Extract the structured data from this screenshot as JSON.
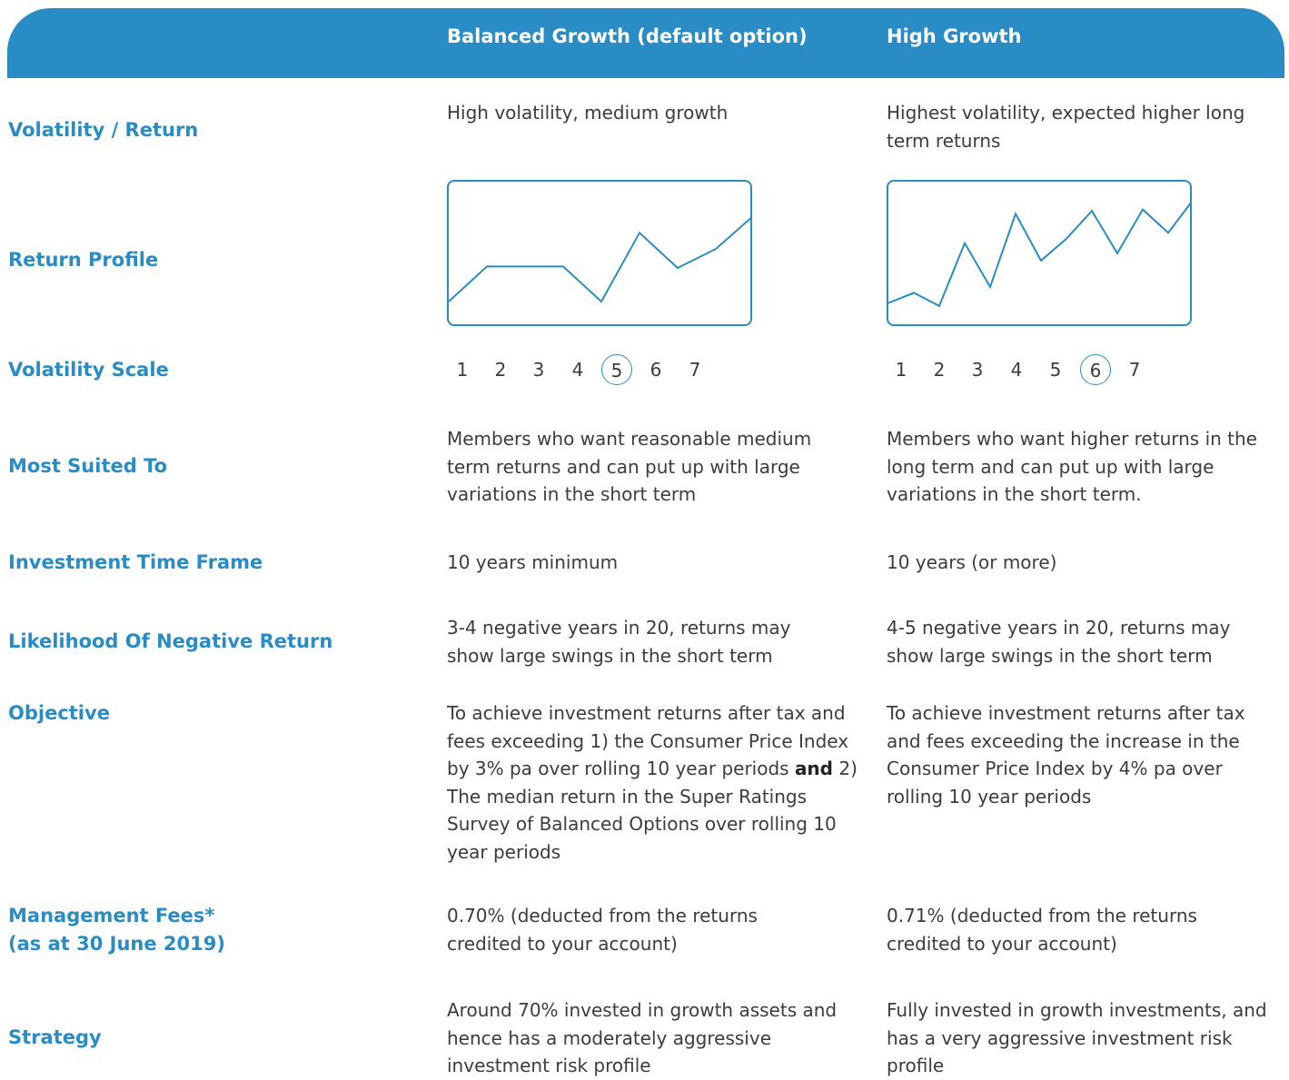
{
  "header": {
    "col1_title": "Balanced Growth (default option)",
    "col2_title": "High Growth"
  },
  "rows": {
    "volatility_return": {
      "label": "Volatility / Return",
      "col1": "High volatility, medium growth",
      "col2": "Highest volatility, expected higher long term returns"
    },
    "return_profile": {
      "label": "Return Profile"
    },
    "volatility_scale": {
      "label": "Volatility Scale",
      "numbers": [
        "1",
        "2",
        "3",
        "4",
        "5",
        "6",
        "7"
      ],
      "col1_selected": 5,
      "col2_selected": 6
    },
    "most_suited": {
      "label": "Most Suited To",
      "col1": "Members who want reasonable medium term returns and can put up with large variations in the short term",
      "col2": "Members who want higher returns in the long term and can put up with large variations in the short term."
    },
    "time_frame": {
      "label": "Investment Time Frame",
      "col1": "10 years minimum",
      "col2": "10 years (or more)"
    },
    "negative_return": {
      "label": "Likelihood Of Negative Return",
      "col1": "3-4 negative years in 20, returns may show large swings in the short term",
      "col2": "4-5 negative years in 20, returns may show large swings in the short term"
    },
    "objective": {
      "label": "Objective",
      "col1_part1": "To achieve investment returns after tax and fees exceeding 1) the Consumer Price Index by 3% pa over rolling 10 year periods",
      "col1_and": "and",
      "col1_part2": "2) The median return in the Super Ratings Survey of Balanced Options over rolling 10 year periods",
      "col2": "To achieve investment returns after tax and fees exceeding the increase in the Consumer Price Index by 4% pa over rolling 10 year periods"
    },
    "management_fees": {
      "label_line1": "Management Fees*",
      "label_line2": "(as at 30 June 2019)",
      "col1": "0.70% (deducted from the returns credited to your account)",
      "col2": "0.71% (deducted from the returns credited to your account)"
    },
    "strategy": {
      "label": "Strategy",
      "col1": "Around 70% invested in growth assets and hence has a moderately aggressive investment risk profile",
      "col2": "Fully invested in growth investments, and has a very aggressive investment risk profile"
    }
  },
  "colors": {
    "accent": "#2a8cc4",
    "text": "#3c3c3c"
  },
  "chart_data": [
    {
      "type": "line",
      "series": [
        {
          "values": [
            0.18,
            0.42,
            0.42,
            0.42,
            0.18,
            0.65,
            0.41,
            0.54,
            0.77
          ]
        }
      ],
      "x": [
        0,
        1,
        2,
        3,
        4,
        5,
        6,
        7,
        8
      ],
      "ylim": [
        0,
        1
      ],
      "grid": false
    },
    {
      "type": "line",
      "series": [
        {
          "values": [
            0.17,
            0.24,
            0.15,
            0.58,
            0.28,
            0.78,
            0.46,
            0.61,
            0.8,
            0.51,
            0.81,
            0.65,
            0.88
          ]
        }
      ],
      "x": [
        0,
        1,
        2,
        3,
        4,
        5,
        6,
        7,
        8,
        9,
        10,
        11,
        12
      ],
      "ylim": [
        0,
        1
      ],
      "grid": false
    }
  ]
}
